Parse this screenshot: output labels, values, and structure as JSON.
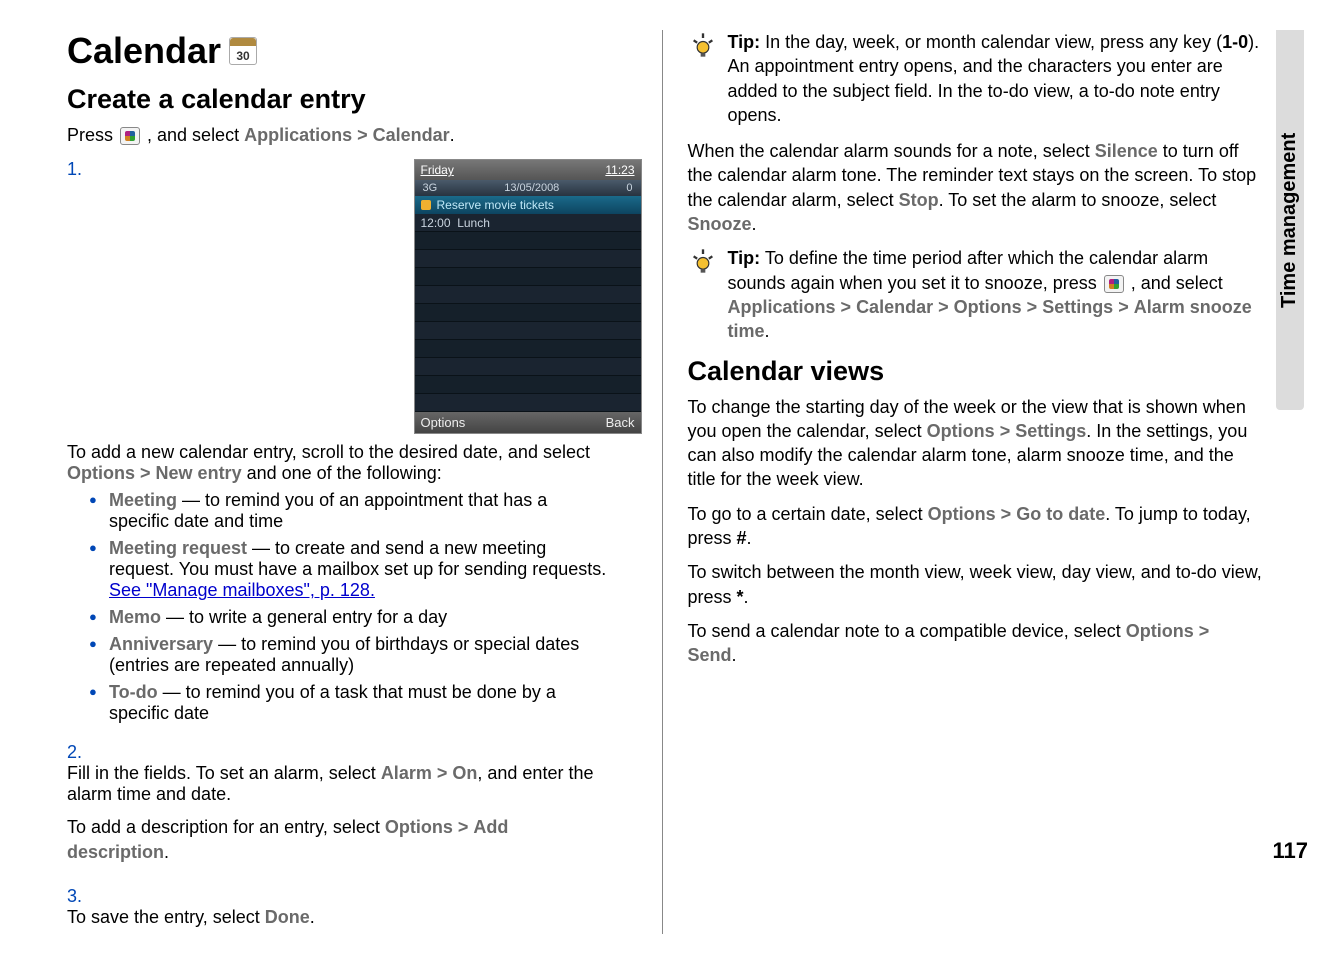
{
  "sideTab": "Time management",
  "pageNumber": "117",
  "left": {
    "h1": "Calendar",
    "calIconDay": "30",
    "h2": "Create a calendar entry",
    "pressPrefix": "Press ",
    "pressMid": " , and select ",
    "pressApps": "Applications",
    "gt": ">",
    "pressCal": "Calendar",
    "period": ".",
    "screenshot": {
      "topLeft": "Friday",
      "topRight": "11:23",
      "netLeft": "3G",
      "date": "13/05/2008",
      "netRight": "0",
      "highlight": "Reserve movie tickets",
      "row1time": "12:00",
      "row1text": "Lunch",
      "optLeft": "Options",
      "optRight": "Back"
    },
    "step1": {
      "num": "1.",
      "intro1": "To add a new calendar entry, scroll to the desired date, and select ",
      "kwOptions": "Options",
      "kwNewEntry": "New entry",
      "intro2": " and one of the following:",
      "bullets": {
        "meeting": {
          "kw": "Meeting",
          "text": "  — to remind you of an appointment that has a specific date and time"
        },
        "meetingReq": {
          "kw": "Meeting request",
          "text": " — to create and send a new meeting request. You must have a mailbox set up for sending requests. ",
          "link": "See \"Manage mailboxes\", p. 128."
        },
        "memo": {
          "kw": "Memo",
          "text": " — to write a general entry for a day"
        },
        "anniv": {
          "kw": "Anniversary",
          "text": " — to remind you of birthdays or special dates (entries are repeated annually)"
        },
        "todo": {
          "kw": "To-do",
          "text": " — to remind you of a task that must be done by a specific date"
        }
      }
    },
    "step2": {
      "num": "2.",
      "p1a": "Fill in the fields. To set an alarm, select ",
      "kwAlarm": "Alarm",
      "kwOn": "On",
      "p1b": ", and enter the alarm time and date.",
      "p2a": "To add a description for an entry, select ",
      "kwOptions": "Options",
      "kwAddDesc": "Add description",
      "p2b": "."
    },
    "step3": {
      "num": "3.",
      "text": "To save the entry, select ",
      "kwDone": "Done",
      "period": "."
    }
  },
  "right": {
    "tip1": {
      "bold": "Tip:",
      "a": " In the day, week, or month calendar view, press any key (",
      "range": "1-0",
      "b": "). An appointment entry opens, and the characters you enter are added to the subject field. In the to-do view, a to-do note entry opens."
    },
    "para1": {
      "a": "When the calendar alarm sounds for a note, select ",
      "kwSilence": "Silence",
      "b": " to turn off the calendar alarm tone. The reminder text stays on the screen. To stop the calendar alarm, select ",
      "kwStop": "Stop",
      "c": ". To set the alarm to snooze, select ",
      "kwSnooze": "Snooze",
      "d": "."
    },
    "tip2": {
      "bold": "Tip:",
      "a": " To define the time period after which the calendar alarm sounds again when you set it to snooze, press ",
      "b": " , and select ",
      "kwApps": "Applications",
      "kwCal": "Calendar",
      "kwOptions": "Options",
      "kwSettings": "Settings",
      "kwAlarmSnooze": "Alarm snooze time",
      "period": "."
    },
    "h2": "Calendar views",
    "para2": {
      "a": "To change the starting day of the week or the view that is shown when you open the calendar, select ",
      "kwOptions": "Options",
      "kwSettings": "Settings",
      "b": ". In the settings, you can also modify the calendar alarm tone, alarm snooze time, and the title for the week view."
    },
    "para3": {
      "a": "To go to a certain date, select ",
      "kwOptions": "Options",
      "kwGoto": "Go to date",
      "b": ". To jump to today, press ",
      "hash": "#",
      "c": "."
    },
    "para4": {
      "a": "To switch between the month view, week view, day view, and to-do view, press ",
      "star": "*",
      "b": "."
    },
    "para5": {
      "a": "To send a calendar note to a compatible device, select ",
      "kwOptions": "Options",
      "kwSend": "Send",
      "b": "."
    }
  }
}
